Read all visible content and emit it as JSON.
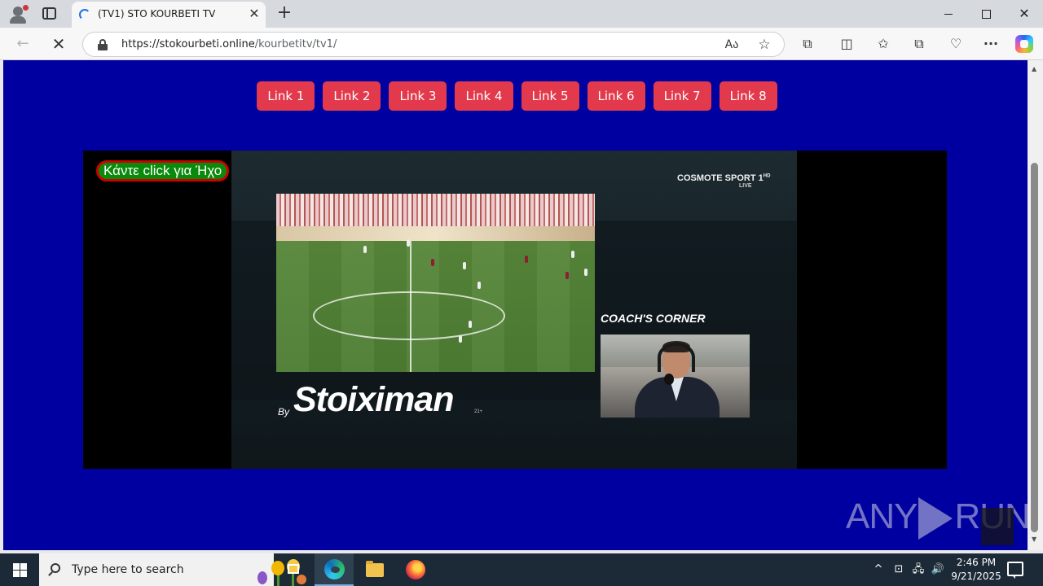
{
  "browser": {
    "tab": {
      "title": "(TV1) STO KOURBETI TV",
      "close_glyph": "✕"
    },
    "new_tab_glyph": "+",
    "window": {
      "minimize": "",
      "maximize": "",
      "close": "✕"
    },
    "address": {
      "host": "https://stokourbeti.online",
      "path": "/kourbetitv/tv1/"
    },
    "icons": {
      "back": "←",
      "stop": "✕",
      "read_aloud": "Aა",
      "favorite": "☆",
      "extensions": "⧉",
      "split": "◫",
      "favorites": "✩",
      "collections": "⧉",
      "performance": "♡",
      "more": "···"
    }
  },
  "page": {
    "links": [
      {
        "label": "Link 1"
      },
      {
        "label": "Link 2"
      },
      {
        "label": "Link 3"
      },
      {
        "label": "Link 4"
      },
      {
        "label": "Link 5"
      },
      {
        "label": "Link 6"
      },
      {
        "label": "Link 7"
      },
      {
        "label": "Link 8"
      }
    ],
    "sound_button": "Κάντε click για Ήχο",
    "stream": {
      "broadcaster": "COSMOTE SPORT 1",
      "broadcaster_hd": "HD",
      "broadcaster_sub": "LIVE",
      "by": "By",
      "sponsor": "Stoiximan",
      "age": "21+",
      "coach_label": "COACH'S CORNER"
    },
    "watermark": {
      "left": "ANY",
      "right": "RUN"
    },
    "colors": {
      "page_bg": "#0000a0",
      "link_bg": "#e23a4c",
      "sound_bg": "#0a8a0a",
      "sound_border": "#cc0000"
    }
  },
  "taskbar": {
    "search_placeholder": "Type here to search",
    "tray": {
      "up": "^",
      "net": "⊡",
      "net2": "🖧",
      "vol": "🔊"
    },
    "time": "2:46 PM",
    "date": "9/21/2025"
  }
}
